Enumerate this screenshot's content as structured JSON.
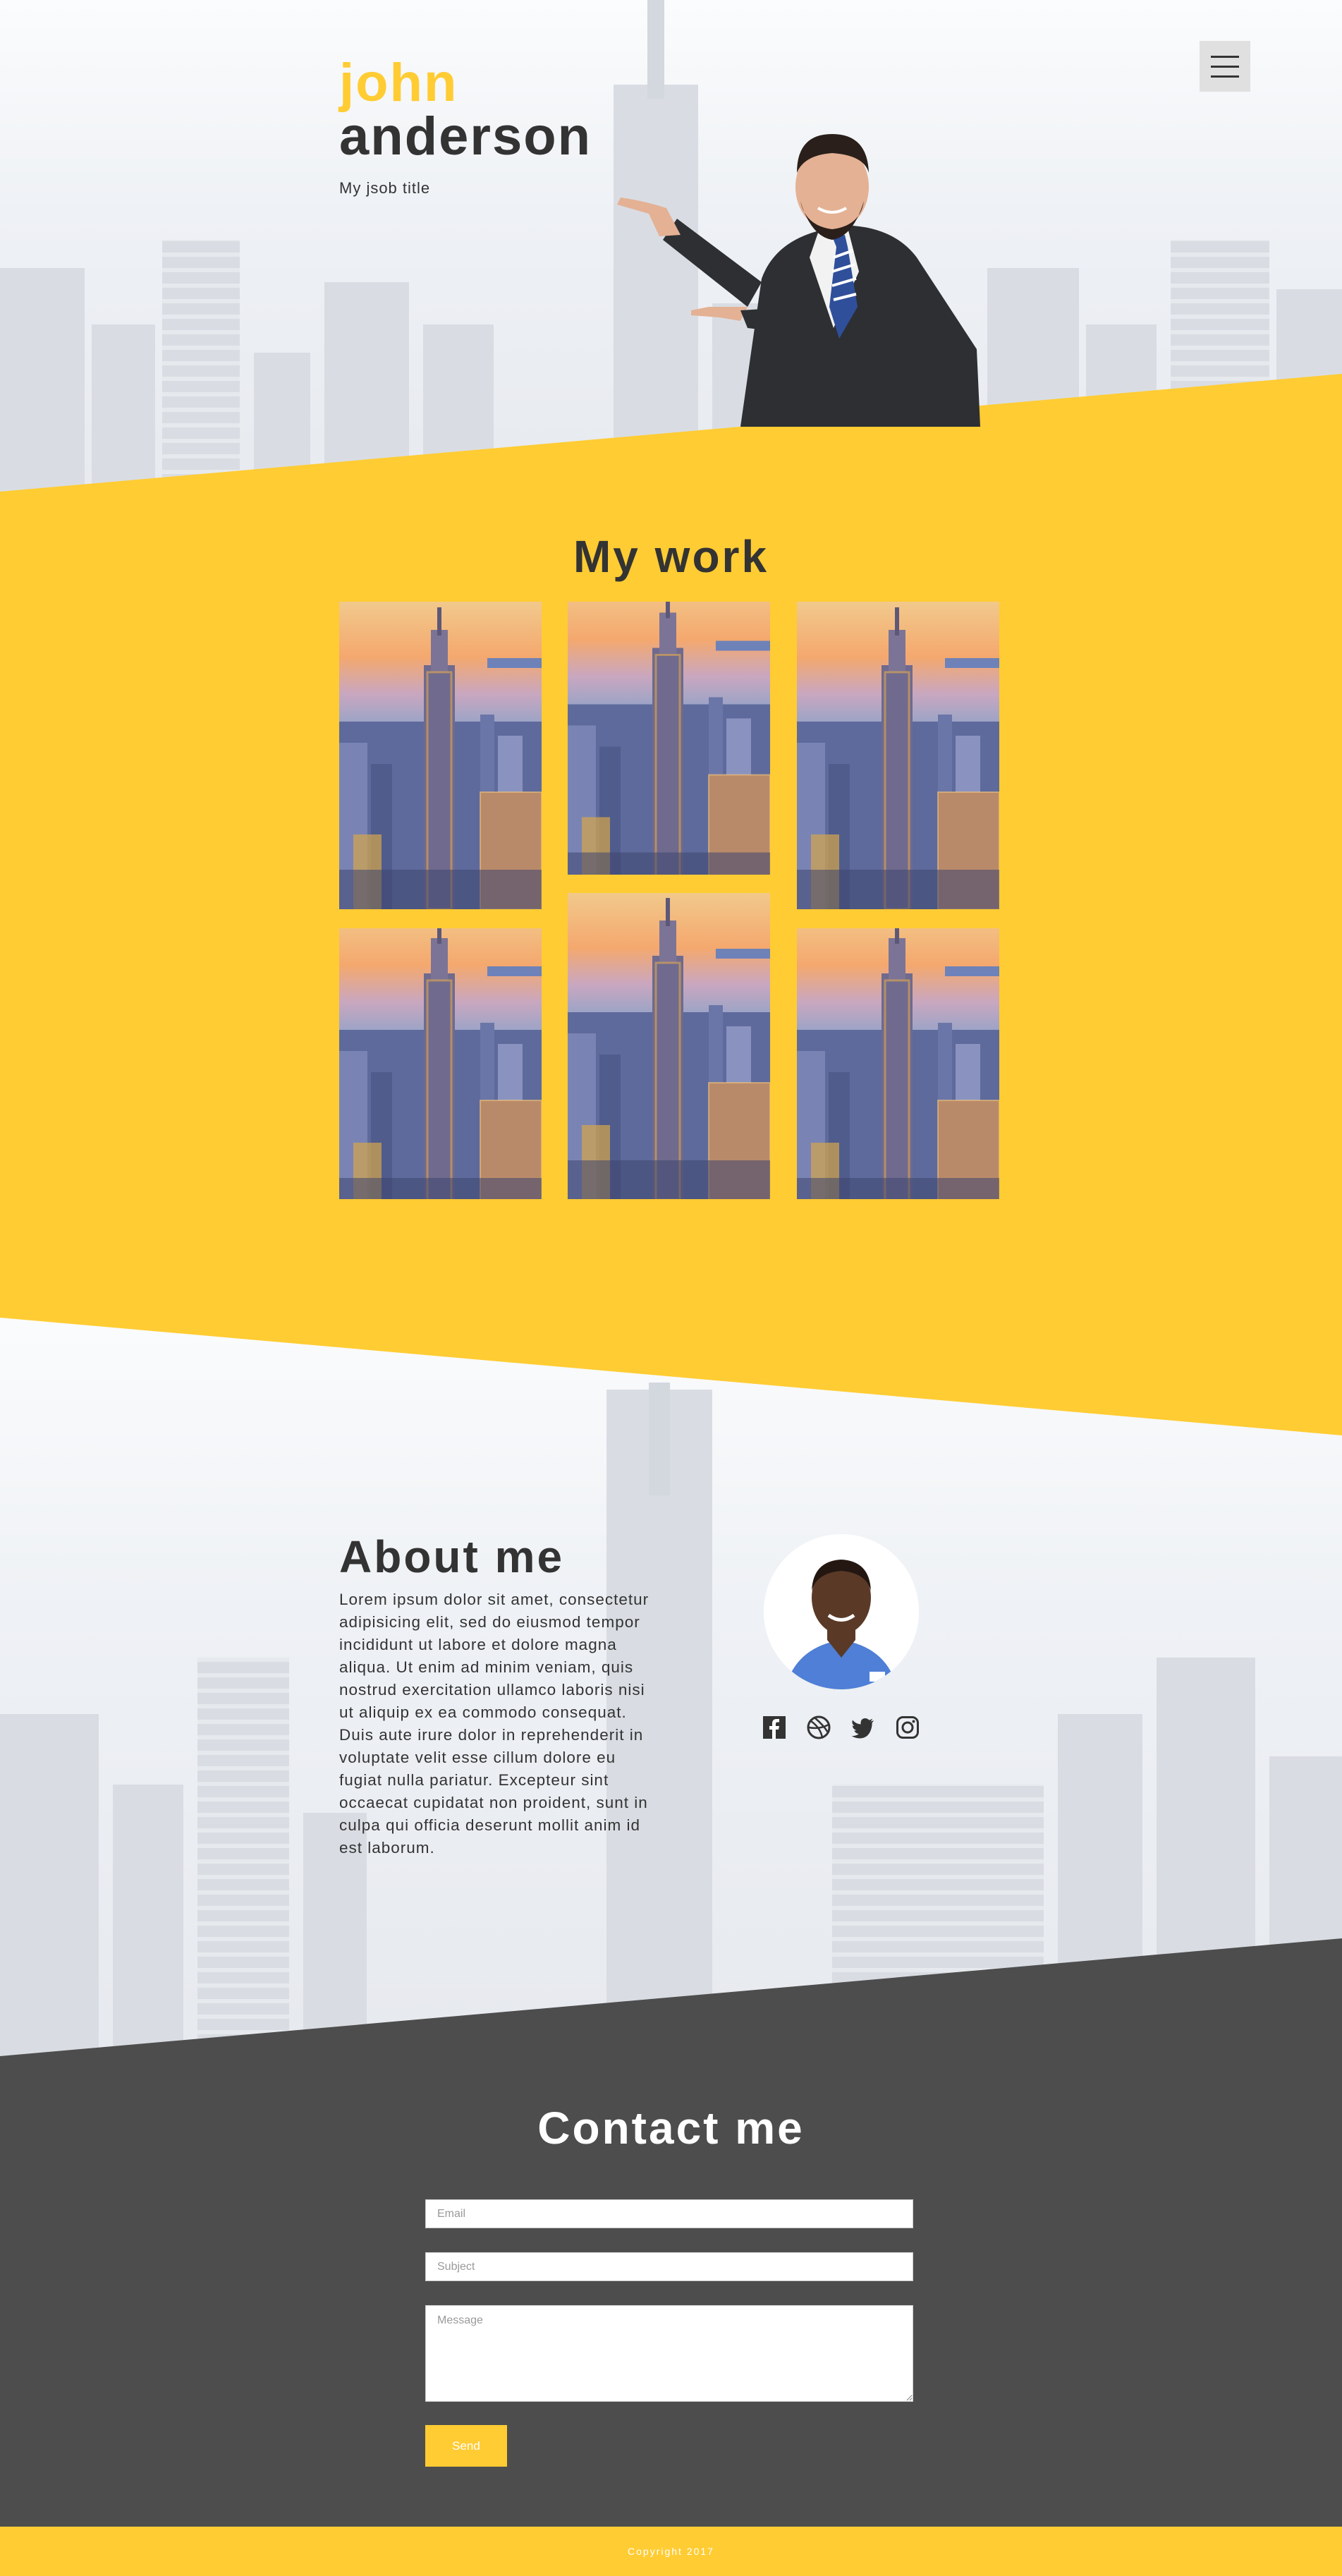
{
  "colors": {
    "accent": "#ffcc33",
    "dark_text": "#333333",
    "contact_bg": "#4d4d4d",
    "menu_bg": "#e0e0e0"
  },
  "header": {
    "first_name": "john",
    "last_name": "anderson",
    "job_title": "My jsob title",
    "menu_icon": "hamburger-menu-icon"
  },
  "work": {
    "title": "My work",
    "tiles": [
      {
        "image": "empire-state-city-photo"
      },
      {
        "image": "empire-state-city-photo"
      },
      {
        "image": "empire-state-city-photo"
      },
      {
        "image": "empire-state-city-photo"
      },
      {
        "image": "empire-state-city-photo"
      },
      {
        "image": "empire-state-city-photo"
      }
    ]
  },
  "about": {
    "title": "About me",
    "text": "Lorem ipsum dolor sit amet, consectetur adipisicing elit, sed do eiusmod tempor incididunt ut labore et dolore magna aliqua. Ut enim ad minim veniam, quis nostrud exercitation ullamco laboris nisi ut aliquip ex ea commodo consequat. Duis aute irure dolor in reprehenderit in voluptate velit esse cillum dolore eu fugiat nulla pariatur. Excepteur sint occaecat cupidatat non proident, sunt in culpa qui officia deserunt mollit anim id est laborum.",
    "socials": [
      {
        "icon": "facebook-icon"
      },
      {
        "icon": "dribbble-icon"
      },
      {
        "icon": "twitter-icon"
      },
      {
        "icon": "instagram-icon"
      }
    ]
  },
  "contact": {
    "title": "Contact me",
    "email_placeholder": "Email",
    "subject_placeholder": "Subject",
    "message_placeholder": "Message",
    "send_label": "Send"
  },
  "footer": {
    "copyright": "Copyright 2017"
  }
}
